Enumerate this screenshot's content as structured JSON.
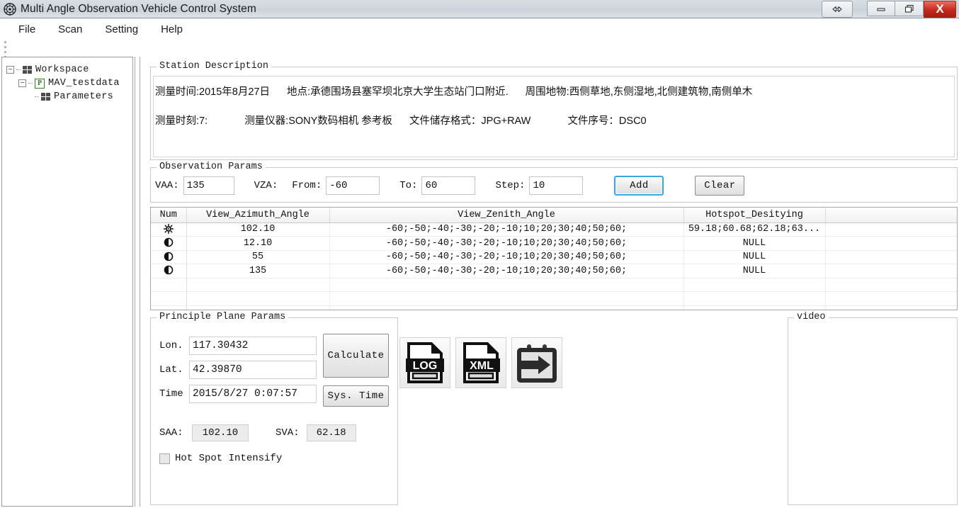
{
  "window": {
    "title": "Multi Angle Observation Vehicle Control System",
    "icon": "app-wheel-icon",
    "buttons": {
      "resize": "⇔",
      "minimize": "–",
      "restore": "❐",
      "close": "X"
    }
  },
  "menu": {
    "items": [
      {
        "label": "File"
      },
      {
        "label": "Scan"
      },
      {
        "label": "Setting"
      },
      {
        "label": "Help"
      }
    ]
  },
  "tree": {
    "nodes": [
      {
        "label": "Workspace",
        "icon": "grid-icon",
        "expander": "−",
        "level": 1
      },
      {
        "label": "MAV_testdata",
        "icon": "project-p-icon",
        "icon_text": "P",
        "expander": "−",
        "level": 2
      },
      {
        "label": "Parameters",
        "icon": "grid-icon",
        "expander": "",
        "level": 3
      }
    ]
  },
  "station": {
    "legend": "Station Description",
    "line1": {
      "time_label": "测量时间:2015年8月27日",
      "place": "地点:承德围场县塞罕坝北京大学生态站门口附近.",
      "surroundings": "周围地物:西侧草地,东侧湿地,北侧建筑物,南侧单木"
    },
    "line2": {
      "moment": "测量时刻:7:",
      "instrument": "测量仪器:SONY数码相机 参考板",
      "format": "文件储存格式：JPG+RAW",
      "serial": "文件序号：DSC0"
    }
  },
  "observation": {
    "legend": "Observation Params",
    "vaa_label": "VAA:",
    "vaa_value": "135",
    "vza_label": "VZA:",
    "from_label": "From:",
    "from_value": "-60",
    "to_label": "To:",
    "to_value": "60",
    "step_label": "Step:",
    "step_value": "10",
    "add_label": "Add",
    "clear_label": "Clear"
  },
  "table": {
    "columns": [
      "Num",
      "View_Azimuth_Angle",
      "View_Zenith_Angle",
      "Hotspot_Desitying",
      ""
    ],
    "rows": [
      {
        "num_icon": "sun-hotspot-icon",
        "azimuth": "102.10",
        "zenith": "-60;-50;-40;-30;-20;-10;10;20;30;40;50;60;",
        "hotspot": "59.18;60.68;62.18;63...",
        "extra": ""
      },
      {
        "num_icon": "half-moon-icon",
        "azimuth": "12.10",
        "zenith": "-60;-50;-40;-30;-20;-10;10;20;30;40;50;60;",
        "hotspot": "NULL",
        "extra": ""
      },
      {
        "num_icon": "half-moon-icon",
        "azimuth": "55",
        "zenith": "-60;-50;-40;-30;-20;-10;10;20;30;40;50;60;",
        "hotspot": "NULL",
        "extra": ""
      },
      {
        "num_icon": "half-moon-icon",
        "azimuth": "135",
        "zenith": "-60;-50;-40;-30;-20;-10;10;20;30;40;50;60;",
        "hotspot": "NULL",
        "extra": ""
      }
    ],
    "empty_rows": 3
  },
  "principle": {
    "legend": "Principle Plane Params",
    "lon_label": "Lon.",
    "lon_value": "117.30432",
    "lat_label": "Lat.",
    "lat_value": "42.39870",
    "time_label": "Time",
    "time_value": "2015/8/27 0:07:57",
    "calculate_label": "Calculate",
    "systime_label": "Sys. Time",
    "saa_label": "SAA:",
    "saa_value": "102.10",
    "sva_label": "SVA:",
    "sva_value": "62.18",
    "hotspot_checkbox_label": "Hot Spot Intensify",
    "hotspot_checked": false
  },
  "filebuttons": [
    {
      "name": "log-file-button",
      "label": "LOG"
    },
    {
      "name": "xml-file-button",
      "label": "XML"
    },
    {
      "name": "export-button",
      "label": ""
    }
  ],
  "video": {
    "legend": "video"
  },
  "colors": {
    "accent_focus": "#3aa8e0",
    "close_red": "#c42b1c",
    "project_green": "#2f7d24",
    "titlebar": "#cfd6dd"
  }
}
